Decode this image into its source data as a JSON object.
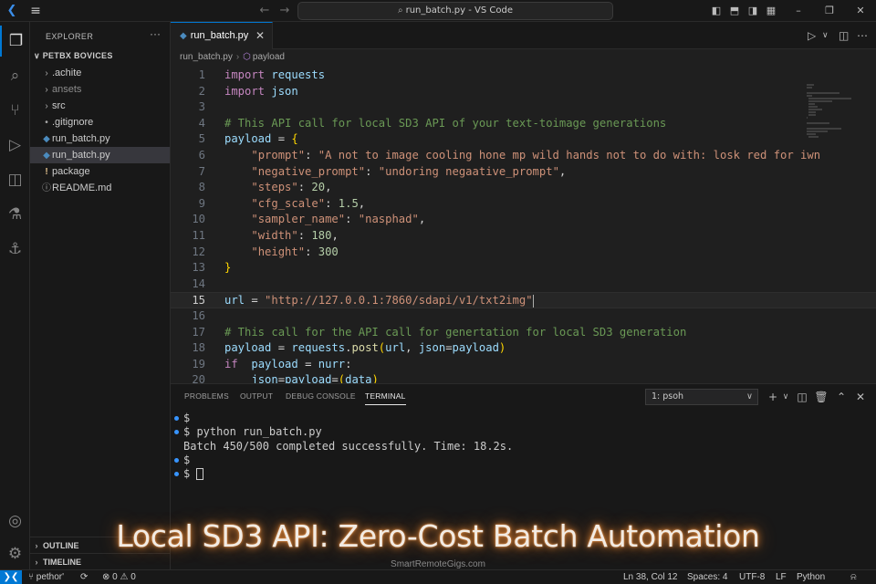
{
  "window": {
    "search_text": "run_batch.py - VS Code"
  },
  "explorer": {
    "title": "EXPLORER",
    "more": "···",
    "folder": "PETBX BOVICES",
    "items": [
      {
        "label": ".achite",
        "kind": "folder"
      },
      {
        "label": "ansets",
        "kind": "folder"
      },
      {
        "label": "src",
        "kind": "folder"
      },
      {
        "label": ".gitignore",
        "kind": "file"
      },
      {
        "label": "run_batch.py",
        "kind": "python"
      },
      {
        "label": "run_batch.py",
        "kind": "python"
      },
      {
        "label": "package",
        "kind": "warning"
      },
      {
        "label": "README.md",
        "kind": "file"
      }
    ],
    "outline": "OUTLINE",
    "timeline": "TIMELINE"
  },
  "editor": {
    "tab_label": "run_batch.py",
    "breadcrumb": {
      "file": "run_batch.py",
      "symbol": "payload"
    },
    "current_line": 15,
    "lines": [
      {
        "n": "1",
        "t": "import requests"
      },
      {
        "n": "2",
        "t": "import json"
      },
      {
        "n": "3",
        "t": ""
      },
      {
        "n": "4",
        "t": "# This API call for local SD3 API of your text-toimage generations"
      },
      {
        "n": "5",
        "t": "payload = {"
      },
      {
        "n": "6",
        "t": "    \"prompt\": \"A not to image cooling hone mp wild hands not to do with: losk red for iwn"
      },
      {
        "n": "7",
        "t": "    \"negative_prompt\": \"undoring negaative_prompt\","
      },
      {
        "n": "8",
        "t": "    \"steps\": 20,"
      },
      {
        "n": "9",
        "t": "    \"cfg_scale\": 1.5,"
      },
      {
        "n": "10",
        "t": "    \"sampler_name\": \"nasphad\","
      },
      {
        "n": "11",
        "t": "    \"width\": 180,"
      },
      {
        "n": "12",
        "t": "    \"height\": 300"
      },
      {
        "n": "13",
        "t": "}"
      },
      {
        "n": "14",
        "t": ""
      },
      {
        "n": "15",
        "t": "url = \"http://127.0.0.1:7860/sdapi/v1/txt2img\""
      },
      {
        "n": "16",
        "t": ""
      },
      {
        "n": "17",
        "t": "# This call for the API call for genertation for local SD3 generation"
      },
      {
        "n": "18",
        "t": "payload = requests.post(url, json=payload)"
      },
      {
        "n": "19",
        "t": "if  payload = nurr:"
      },
      {
        "n": "20",
        "t": "    json=payload=(data)"
      }
    ]
  },
  "panel": {
    "tabs": [
      "PROBLEMS",
      "OUTPUT",
      "DEBUG CONSOLE",
      "TERMINAL"
    ],
    "active_tab": "TERMINAL",
    "terminal_select": "1: psoh",
    "terminal_lines": [
      "$",
      "$ python run_batch.py",
      "Batch 450/500 completed successfully. Time: 18.2s.",
      "$",
      "$"
    ]
  },
  "status": {
    "branch": "pethor'",
    "errors": "0",
    "warnings": "0",
    "position": "Ln 38, Col 12",
    "spaces": "Spaces: 4",
    "encoding": "UTF-8",
    "eol": "LF",
    "language": "Python"
  },
  "overlay": {
    "caption": "Local SD3 API: Zero-Cost Batch Automation",
    "watermark": "SmartRemoteGigs.com"
  },
  "colors": {
    "accent": "#0078d4",
    "caption_glow": "#ff9a3c"
  }
}
